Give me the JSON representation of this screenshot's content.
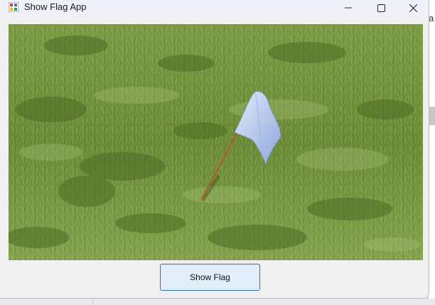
{
  "window": {
    "title": "Show Flag App"
  },
  "caption_buttons": {
    "minimize_icon": "minimize-icon",
    "maximize_icon": "maximize-icon",
    "close_icon": "close-icon"
  },
  "picture": {
    "icon": "photo-grass-flag"
  },
  "actions": {
    "show_flag_label": "Show Flag"
  },
  "background": {
    "edge_glyph": "a"
  },
  "colors": {
    "titlebar": "#eef2f8",
    "window_bg": "#f0f0f0",
    "button_bg": "#e2eefb",
    "button_border": "#2f6fae",
    "grass": "#6e8f3d"
  }
}
